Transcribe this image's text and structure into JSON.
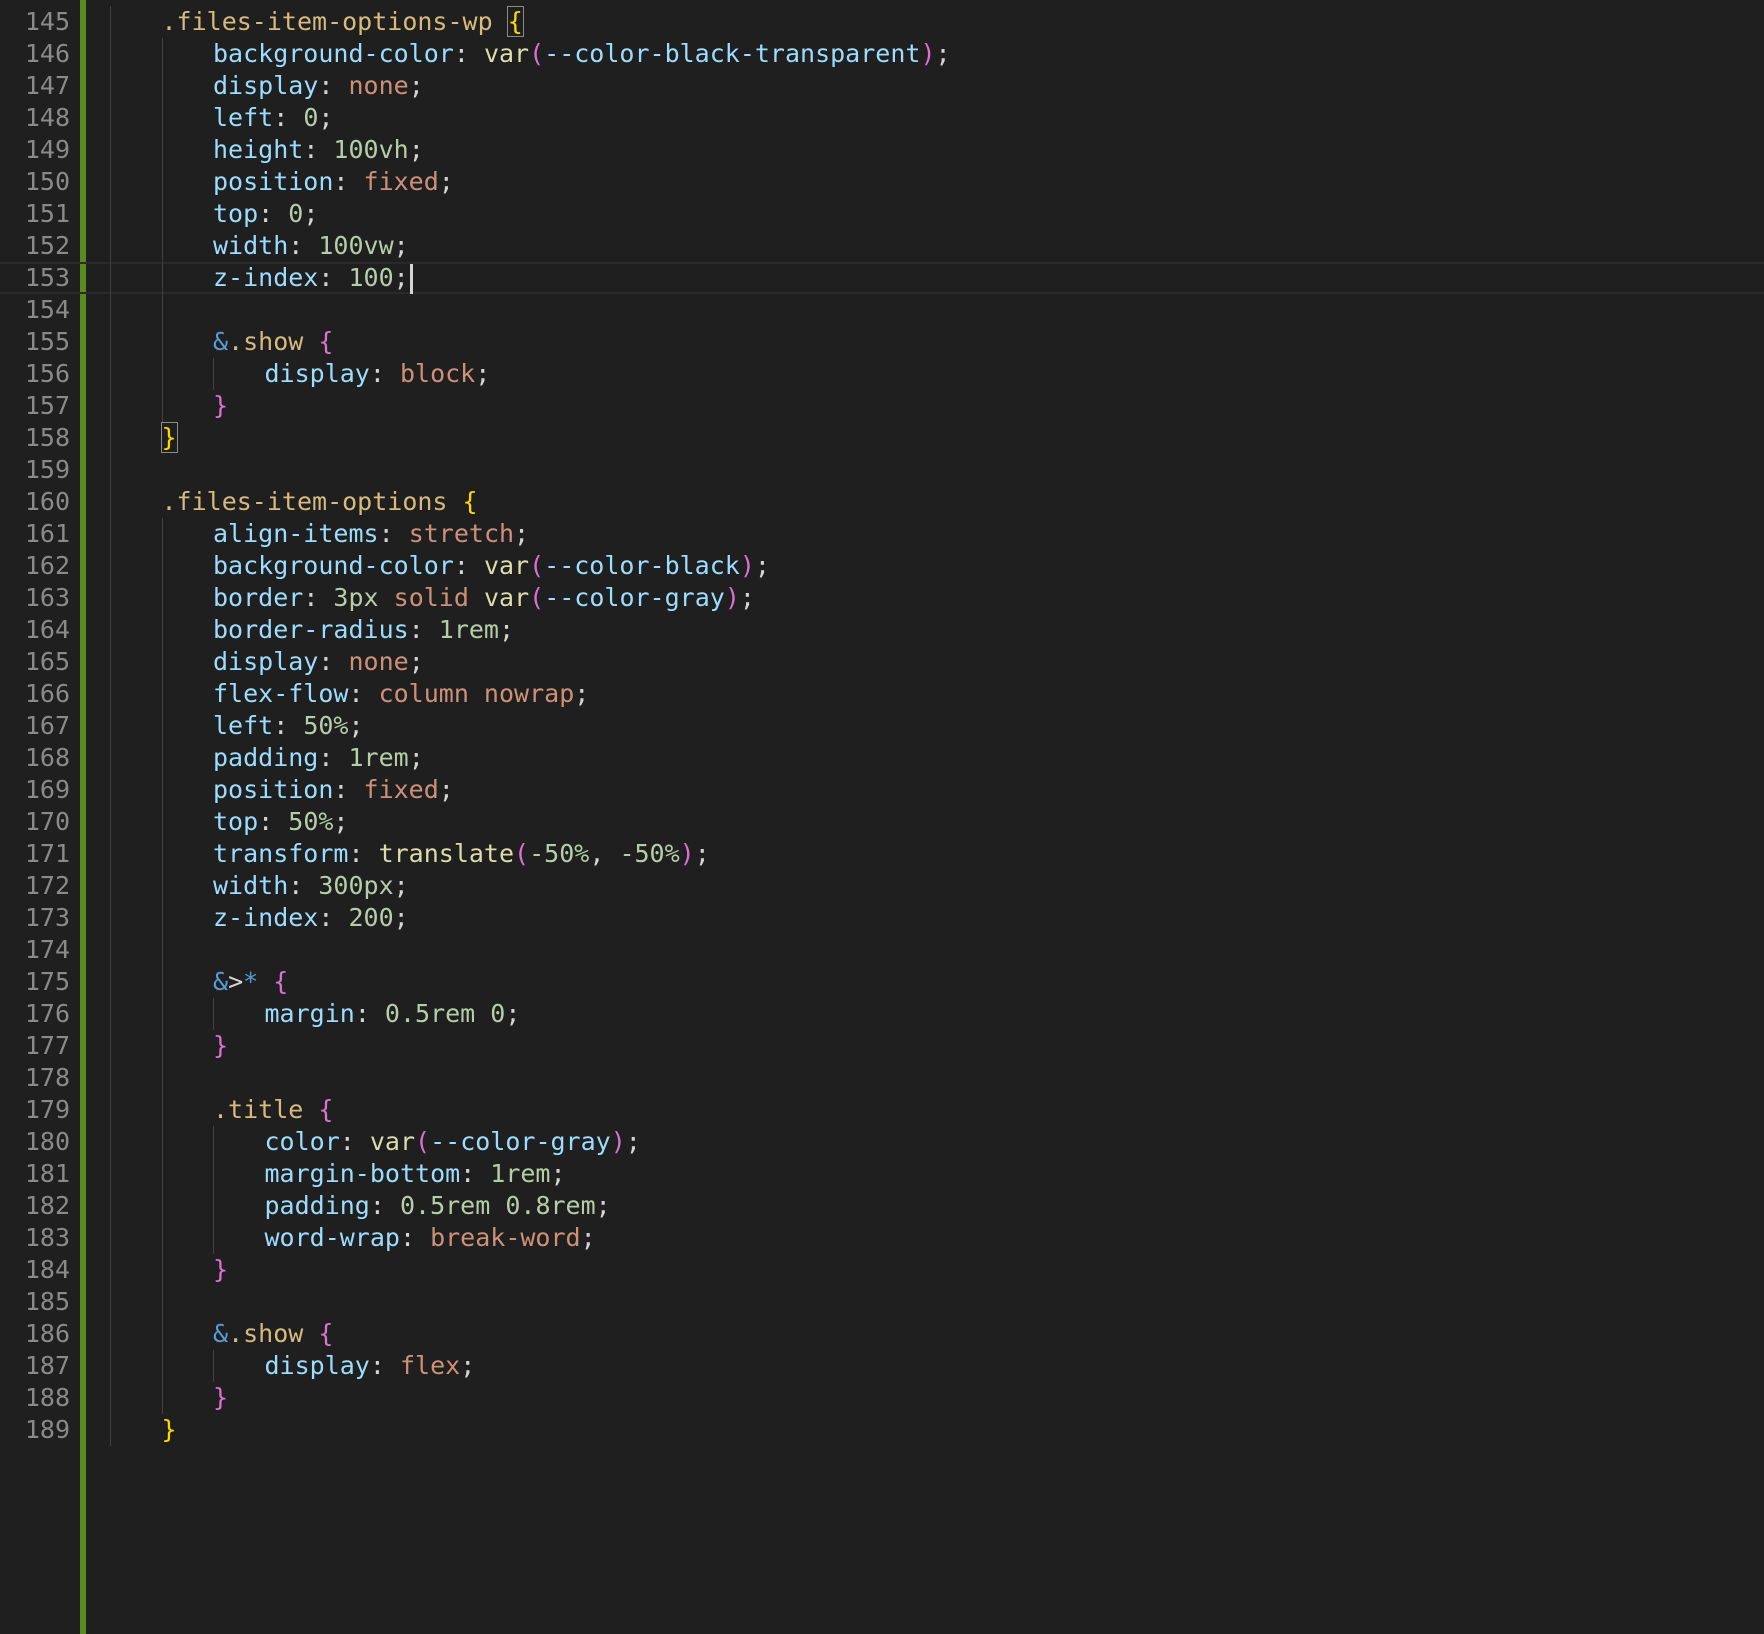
{
  "editor": {
    "language": "scss",
    "cursor_line": 153,
    "colors": {
      "background": "#1f1f1f",
      "line_number": "#8a8a8a",
      "git_modified_bar": "#5b8a1e",
      "selector": "#d7ba7d",
      "property": "#9cdcfe",
      "keyword_value": "#ce9178",
      "number": "#b5cea8",
      "function": "#dcdcaa",
      "variable": "#9cdcfe",
      "punctuation": "#d4d4d4",
      "ampersand": "#569cd6",
      "bracket_gold": "#ffd700",
      "bracket_pink": "#da70d6"
    },
    "lines": [
      {
        "n": "145",
        "indent": 1,
        "tokens": [
          {
            "t": ".files-item-options-wp ",
            "c": "selector"
          },
          {
            "t": "{",
            "c": "bracket_gold",
            "match": true
          }
        ]
      },
      {
        "n": "146",
        "indent": 2,
        "tokens": [
          {
            "t": "background-color",
            "c": "property"
          },
          {
            "t": ": ",
            "c": "punctuation"
          },
          {
            "t": "var",
            "c": "function"
          },
          {
            "t": "(",
            "c": "bracket_pink"
          },
          {
            "t": "--color-black-transparent",
            "c": "variable"
          },
          {
            "t": ")",
            "c": "bracket_pink"
          },
          {
            "t": ";",
            "c": "punctuation"
          }
        ]
      },
      {
        "n": "147",
        "indent": 2,
        "tokens": [
          {
            "t": "display",
            "c": "property"
          },
          {
            "t": ": ",
            "c": "punctuation"
          },
          {
            "t": "none",
            "c": "keyword_value"
          },
          {
            "t": ";",
            "c": "punctuation"
          }
        ]
      },
      {
        "n": "148",
        "indent": 2,
        "tokens": [
          {
            "t": "left",
            "c": "property"
          },
          {
            "t": ": ",
            "c": "punctuation"
          },
          {
            "t": "0",
            "c": "number"
          },
          {
            "t": ";",
            "c": "punctuation"
          }
        ]
      },
      {
        "n": "149",
        "indent": 2,
        "tokens": [
          {
            "t": "height",
            "c": "property"
          },
          {
            "t": ": ",
            "c": "punctuation"
          },
          {
            "t": "100vh",
            "c": "number"
          },
          {
            "t": ";",
            "c": "punctuation"
          }
        ]
      },
      {
        "n": "150",
        "indent": 2,
        "tokens": [
          {
            "t": "position",
            "c": "property"
          },
          {
            "t": ": ",
            "c": "punctuation"
          },
          {
            "t": "fixed",
            "c": "keyword_value"
          },
          {
            "t": ";",
            "c": "punctuation"
          }
        ]
      },
      {
        "n": "151",
        "indent": 2,
        "tokens": [
          {
            "t": "top",
            "c": "property"
          },
          {
            "t": ": ",
            "c": "punctuation"
          },
          {
            "t": "0",
            "c": "number"
          },
          {
            "t": ";",
            "c": "punctuation"
          }
        ]
      },
      {
        "n": "152",
        "indent": 2,
        "tokens": [
          {
            "t": "width",
            "c": "property"
          },
          {
            "t": ": ",
            "c": "punctuation"
          },
          {
            "t": "100vw",
            "c": "number"
          },
          {
            "t": ";",
            "c": "punctuation"
          }
        ]
      },
      {
        "n": "153",
        "indent": 2,
        "cursor": true,
        "tokens": [
          {
            "t": "z-index",
            "c": "property"
          },
          {
            "t": ": ",
            "c": "punctuation"
          },
          {
            "t": "100",
            "c": "number"
          },
          {
            "t": ";",
            "c": "punctuation"
          }
        ]
      },
      {
        "n": "154",
        "indent": 0,
        "tokens": []
      },
      {
        "n": "155",
        "indent": 2,
        "tokens": [
          {
            "t": "&",
            "c": "ampersand"
          },
          {
            "t": ".show ",
            "c": "selector"
          },
          {
            "t": "{",
            "c": "bracket_pink"
          }
        ]
      },
      {
        "n": "156",
        "indent": 3,
        "tokens": [
          {
            "t": "display",
            "c": "property"
          },
          {
            "t": ": ",
            "c": "punctuation"
          },
          {
            "t": "block",
            "c": "keyword_value"
          },
          {
            "t": ";",
            "c": "punctuation"
          }
        ]
      },
      {
        "n": "157",
        "indent": 2,
        "tokens": [
          {
            "t": "}",
            "c": "bracket_pink"
          }
        ]
      },
      {
        "n": "158",
        "indent": 1,
        "tokens": [
          {
            "t": "}",
            "c": "bracket_gold",
            "match": true
          }
        ]
      },
      {
        "n": "159",
        "indent": 0,
        "tokens": []
      },
      {
        "n": "160",
        "indent": 1,
        "tokens": [
          {
            "t": ".files-item-options ",
            "c": "selector"
          },
          {
            "t": "{",
            "c": "bracket_gold"
          }
        ]
      },
      {
        "n": "161",
        "indent": 2,
        "tokens": [
          {
            "t": "align-items",
            "c": "property"
          },
          {
            "t": ": ",
            "c": "punctuation"
          },
          {
            "t": "stretch",
            "c": "keyword_value"
          },
          {
            "t": ";",
            "c": "punctuation"
          }
        ]
      },
      {
        "n": "162",
        "indent": 2,
        "tokens": [
          {
            "t": "background-color",
            "c": "property"
          },
          {
            "t": ": ",
            "c": "punctuation"
          },
          {
            "t": "var",
            "c": "function"
          },
          {
            "t": "(",
            "c": "bracket_pink"
          },
          {
            "t": "--color-black",
            "c": "variable"
          },
          {
            "t": ")",
            "c": "bracket_pink"
          },
          {
            "t": ";",
            "c": "punctuation"
          }
        ]
      },
      {
        "n": "163",
        "indent": 2,
        "tokens": [
          {
            "t": "border",
            "c": "property"
          },
          {
            "t": ": ",
            "c": "punctuation"
          },
          {
            "t": "3px",
            "c": "number"
          },
          {
            "t": " ",
            "c": "punctuation"
          },
          {
            "t": "solid",
            "c": "keyword_value"
          },
          {
            "t": " ",
            "c": "punctuation"
          },
          {
            "t": "var",
            "c": "function"
          },
          {
            "t": "(",
            "c": "bracket_pink"
          },
          {
            "t": "--color-gray",
            "c": "variable"
          },
          {
            "t": ")",
            "c": "bracket_pink"
          },
          {
            "t": ";",
            "c": "punctuation"
          }
        ]
      },
      {
        "n": "164",
        "indent": 2,
        "tokens": [
          {
            "t": "border-radius",
            "c": "property"
          },
          {
            "t": ": ",
            "c": "punctuation"
          },
          {
            "t": "1rem",
            "c": "number"
          },
          {
            "t": ";",
            "c": "punctuation"
          }
        ]
      },
      {
        "n": "165",
        "indent": 2,
        "tokens": [
          {
            "t": "display",
            "c": "property"
          },
          {
            "t": ": ",
            "c": "punctuation"
          },
          {
            "t": "none",
            "c": "keyword_value"
          },
          {
            "t": ";",
            "c": "punctuation"
          }
        ]
      },
      {
        "n": "166",
        "indent": 2,
        "tokens": [
          {
            "t": "flex-flow",
            "c": "property"
          },
          {
            "t": ": ",
            "c": "punctuation"
          },
          {
            "t": "column nowrap",
            "c": "keyword_value"
          },
          {
            "t": ";",
            "c": "punctuation"
          }
        ]
      },
      {
        "n": "167",
        "indent": 2,
        "tokens": [
          {
            "t": "left",
            "c": "property"
          },
          {
            "t": ": ",
            "c": "punctuation"
          },
          {
            "t": "50%",
            "c": "number"
          },
          {
            "t": ";",
            "c": "punctuation"
          }
        ]
      },
      {
        "n": "168",
        "indent": 2,
        "tokens": [
          {
            "t": "padding",
            "c": "property"
          },
          {
            "t": ": ",
            "c": "punctuation"
          },
          {
            "t": "1rem",
            "c": "number"
          },
          {
            "t": ";",
            "c": "punctuation"
          }
        ]
      },
      {
        "n": "169",
        "indent": 2,
        "tokens": [
          {
            "t": "position",
            "c": "property"
          },
          {
            "t": ": ",
            "c": "punctuation"
          },
          {
            "t": "fixed",
            "c": "keyword_value"
          },
          {
            "t": ";",
            "c": "punctuation"
          }
        ]
      },
      {
        "n": "170",
        "indent": 2,
        "tokens": [
          {
            "t": "top",
            "c": "property"
          },
          {
            "t": ": ",
            "c": "punctuation"
          },
          {
            "t": "50%",
            "c": "number"
          },
          {
            "t": ";",
            "c": "punctuation"
          }
        ]
      },
      {
        "n": "171",
        "indent": 2,
        "tokens": [
          {
            "t": "transform",
            "c": "property"
          },
          {
            "t": ": ",
            "c": "punctuation"
          },
          {
            "t": "translate",
            "c": "function"
          },
          {
            "t": "(",
            "c": "bracket_pink"
          },
          {
            "t": "-50%",
            "c": "number"
          },
          {
            "t": ", ",
            "c": "punctuation"
          },
          {
            "t": "-50%",
            "c": "number"
          },
          {
            "t": ")",
            "c": "bracket_pink"
          },
          {
            "t": ";",
            "c": "punctuation"
          }
        ]
      },
      {
        "n": "172",
        "indent": 2,
        "tokens": [
          {
            "t": "width",
            "c": "property"
          },
          {
            "t": ": ",
            "c": "punctuation"
          },
          {
            "t": "300px",
            "c": "number"
          },
          {
            "t": ";",
            "c": "punctuation"
          }
        ]
      },
      {
        "n": "173",
        "indent": 2,
        "tokens": [
          {
            "t": "z-index",
            "c": "property"
          },
          {
            "t": ": ",
            "c": "punctuation"
          },
          {
            "t": "200",
            "c": "number"
          },
          {
            "t": ";",
            "c": "punctuation"
          }
        ]
      },
      {
        "n": "174",
        "indent": 0,
        "tokens": []
      },
      {
        "n": "175",
        "indent": 2,
        "tokens": [
          {
            "t": "&",
            "c": "ampersand"
          },
          {
            "t": ">",
            "c": "punctuation"
          },
          {
            "t": "* ",
            "c": "ampersand"
          },
          {
            "t": "{",
            "c": "bracket_pink"
          }
        ]
      },
      {
        "n": "176",
        "indent": 3,
        "tokens": [
          {
            "t": "margin",
            "c": "property"
          },
          {
            "t": ": ",
            "c": "punctuation"
          },
          {
            "t": "0.5rem",
            "c": "number"
          },
          {
            "t": " ",
            "c": "punctuation"
          },
          {
            "t": "0",
            "c": "number"
          },
          {
            "t": ";",
            "c": "punctuation"
          }
        ]
      },
      {
        "n": "177",
        "indent": 2,
        "tokens": [
          {
            "t": "}",
            "c": "bracket_pink"
          }
        ]
      },
      {
        "n": "178",
        "indent": 0,
        "tokens": []
      },
      {
        "n": "179",
        "indent": 2,
        "tokens": [
          {
            "t": ".title ",
            "c": "selector"
          },
          {
            "t": "{",
            "c": "bracket_pink"
          }
        ]
      },
      {
        "n": "180",
        "indent": 3,
        "tokens": [
          {
            "t": "color",
            "c": "property"
          },
          {
            "t": ": ",
            "c": "punctuation"
          },
          {
            "t": "var",
            "c": "function"
          },
          {
            "t": "(",
            "c": "bracket_pink"
          },
          {
            "t": "--color-gray",
            "c": "variable"
          },
          {
            "t": ")",
            "c": "bracket_pink"
          },
          {
            "t": ";",
            "c": "punctuation"
          }
        ]
      },
      {
        "n": "181",
        "indent": 3,
        "tokens": [
          {
            "t": "margin-bottom",
            "c": "property"
          },
          {
            "t": ": ",
            "c": "punctuation"
          },
          {
            "t": "1rem",
            "c": "number"
          },
          {
            "t": ";",
            "c": "punctuation"
          }
        ]
      },
      {
        "n": "182",
        "indent": 3,
        "tokens": [
          {
            "t": "padding",
            "c": "property"
          },
          {
            "t": ": ",
            "c": "punctuation"
          },
          {
            "t": "0.5rem",
            "c": "number"
          },
          {
            "t": " ",
            "c": "punctuation"
          },
          {
            "t": "0.8rem",
            "c": "number"
          },
          {
            "t": ";",
            "c": "punctuation"
          }
        ]
      },
      {
        "n": "183",
        "indent": 3,
        "tokens": [
          {
            "t": "word-wrap",
            "c": "property"
          },
          {
            "t": ": ",
            "c": "punctuation"
          },
          {
            "t": "break-word",
            "c": "keyword_value"
          },
          {
            "t": ";",
            "c": "punctuation"
          }
        ]
      },
      {
        "n": "184",
        "indent": 2,
        "tokens": [
          {
            "t": "}",
            "c": "bracket_pink"
          }
        ]
      },
      {
        "n": "185",
        "indent": 0,
        "tokens": []
      },
      {
        "n": "186",
        "indent": 2,
        "tokens": [
          {
            "t": "&",
            "c": "ampersand"
          },
          {
            "t": ".show ",
            "c": "selector"
          },
          {
            "t": "{",
            "c": "bracket_pink"
          }
        ]
      },
      {
        "n": "187",
        "indent": 3,
        "tokens": [
          {
            "t": "display",
            "c": "property"
          },
          {
            "t": ": ",
            "c": "punctuation"
          },
          {
            "t": "flex",
            "c": "keyword_value"
          },
          {
            "t": ";",
            "c": "punctuation"
          }
        ]
      },
      {
        "n": "188",
        "indent": 2,
        "tokens": [
          {
            "t": "}",
            "c": "bracket_pink"
          }
        ]
      },
      {
        "n": "189",
        "indent": 1,
        "tokens": [
          {
            "t": "}",
            "c": "bracket_gold"
          }
        ]
      }
    ]
  }
}
